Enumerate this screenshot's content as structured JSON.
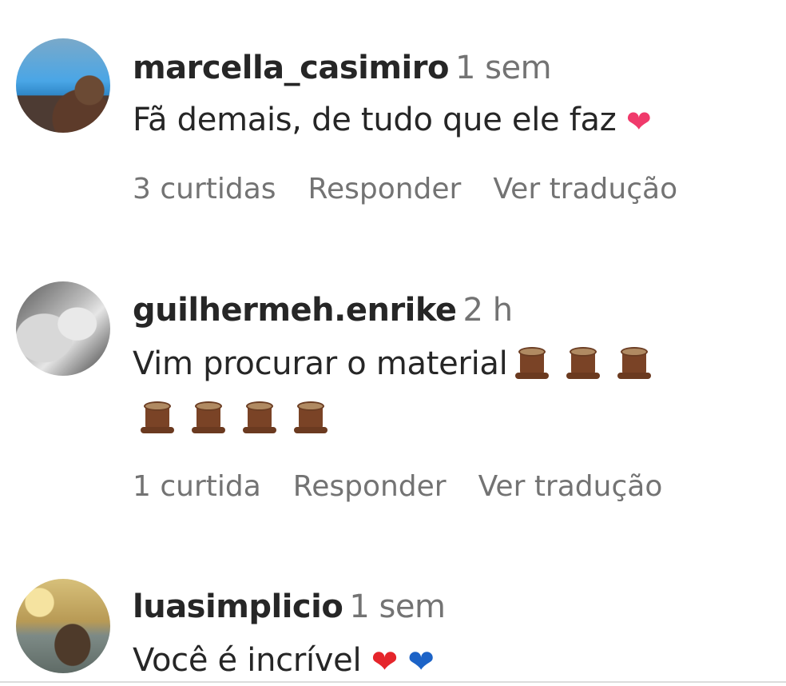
{
  "comments": [
    {
      "username": "marcella_casimiro",
      "time": "1 sem",
      "text": "Fã demais, de tudo que ele faz",
      "emojis": [
        "heart-pink-icon"
      ],
      "likes": "3 curtidas",
      "reply": "Responder",
      "translate": "Ver tradução"
    },
    {
      "username": "guilhermeh.enrike",
      "time": "2 h",
      "text": "Vim procurar o material",
      "emojis": [
        "tree-stump-icon",
        "tree-stump-icon",
        "tree-stump-icon",
        "tree-stump-icon",
        "tree-stump-icon",
        "tree-stump-icon",
        "tree-stump-icon"
      ],
      "likes": "1 curtida",
      "reply": "Responder",
      "translate": "Ver tradução"
    },
    {
      "username": "luasimplicio",
      "time": "1 sem",
      "text": "Você é incrível",
      "emojis": [
        "red-heart-icon",
        "blue-heart-icon"
      ]
    }
  ],
  "colors": {
    "text": "#262626",
    "secondary": "#737373",
    "heart_pink": "#f03a6b",
    "heart_red": "#e5252b",
    "heart_blue": "#1c63c7"
  }
}
